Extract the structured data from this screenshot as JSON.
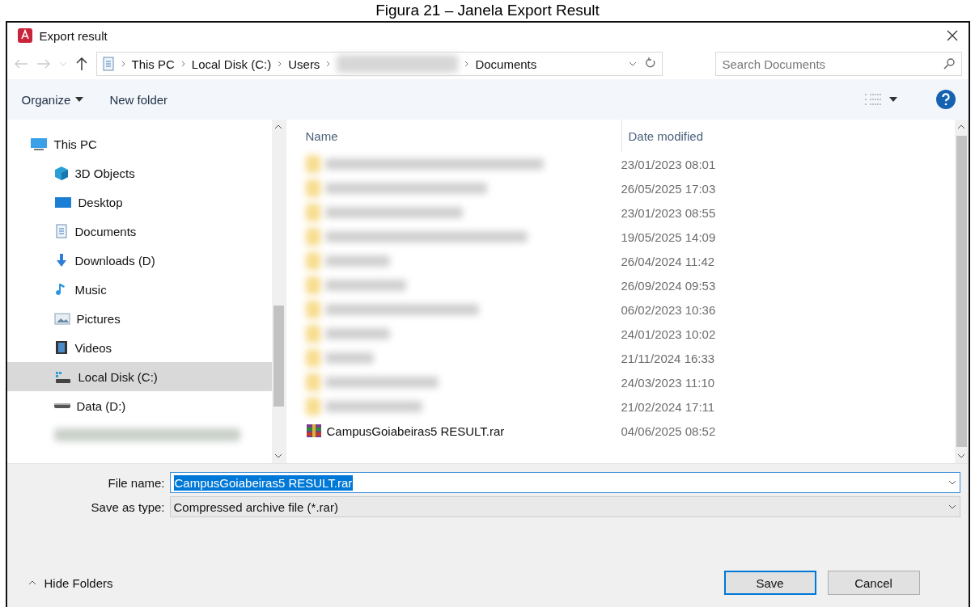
{
  "caption": "Figura 21 – Janela Export Result",
  "window": {
    "title": "Export result"
  },
  "address_bar": {
    "breadcrumbs": [
      {
        "label": "This PC"
      },
      {
        "label": "Local Disk (C:)"
      },
      {
        "label": "Users"
      },
      {
        "kind": "blurred"
      },
      {
        "label": "Documents"
      }
    ]
  },
  "search": {
    "placeholder": "Search Documents"
  },
  "toolbar": {
    "organize": "Organize",
    "new_folder": "New folder"
  },
  "sidebar": {
    "items": [
      {
        "label": "This PC",
        "kind": "pc",
        "selected": false,
        "children": [
          {
            "label": "3D Objects",
            "kind": "cube",
            "selected": false
          },
          {
            "label": "Desktop",
            "kind": "desktop",
            "selected": false
          },
          {
            "label": "Documents",
            "kind": "documents",
            "selected": false
          },
          {
            "label": "Downloads (D)",
            "kind": "download",
            "selected": false
          },
          {
            "label": "Music",
            "kind": "music",
            "selected": false
          },
          {
            "label": "Pictures",
            "kind": "pictures",
            "selected": false
          },
          {
            "label": "Videos",
            "kind": "videos",
            "selected": false
          },
          {
            "label": "Local Disk (C:)",
            "kind": "disk",
            "selected": true
          },
          {
            "label": "Data (D:)",
            "kind": "drive",
            "selected": false
          },
          {
            "kind": "blurred",
            "selected": false
          }
        ]
      }
    ]
  },
  "file_list": {
    "columns": [
      "Name",
      "Date modified"
    ],
    "rows": [
      {
        "kind": "blurred",
        "date": "23/01/2023 08:01"
      },
      {
        "kind": "blurred",
        "date": "26/05/2025 17:03"
      },
      {
        "kind": "blurred",
        "date": "23/01/2023 08:55"
      },
      {
        "kind": "blurred",
        "date": "19/05/2025 14:09"
      },
      {
        "kind": "blurred",
        "date": "26/04/2024 11:42"
      },
      {
        "kind": "blurred",
        "date": "26/09/2024 09:53"
      },
      {
        "kind": "blurred",
        "date": "06/02/2023 10:36"
      },
      {
        "kind": "blurred",
        "date": "24/01/2023 10:02"
      },
      {
        "kind": "blurred",
        "date": "21/11/2024 16:33"
      },
      {
        "kind": "blurred",
        "date": "24/03/2023 11:10"
      },
      {
        "kind": "blurred",
        "date": "21/02/2024 17:11"
      },
      {
        "kind": "archive",
        "name": "CampusGoiabeiras5 RESULT.rar",
        "date": "04/06/2025 08:52"
      }
    ]
  },
  "file_name": {
    "label": "File name:",
    "value": "CampusGoiabeiras5 RESULT.rar",
    "text_selected": true
  },
  "save_type": {
    "label": "Save as type:",
    "value": "Compressed archive file (*.rar)"
  },
  "hide_folders": "Hide Folders",
  "buttons": [
    {
      "label": "Save",
      "default": true
    },
    {
      "label": "Cancel",
      "default": false
    }
  ]
}
